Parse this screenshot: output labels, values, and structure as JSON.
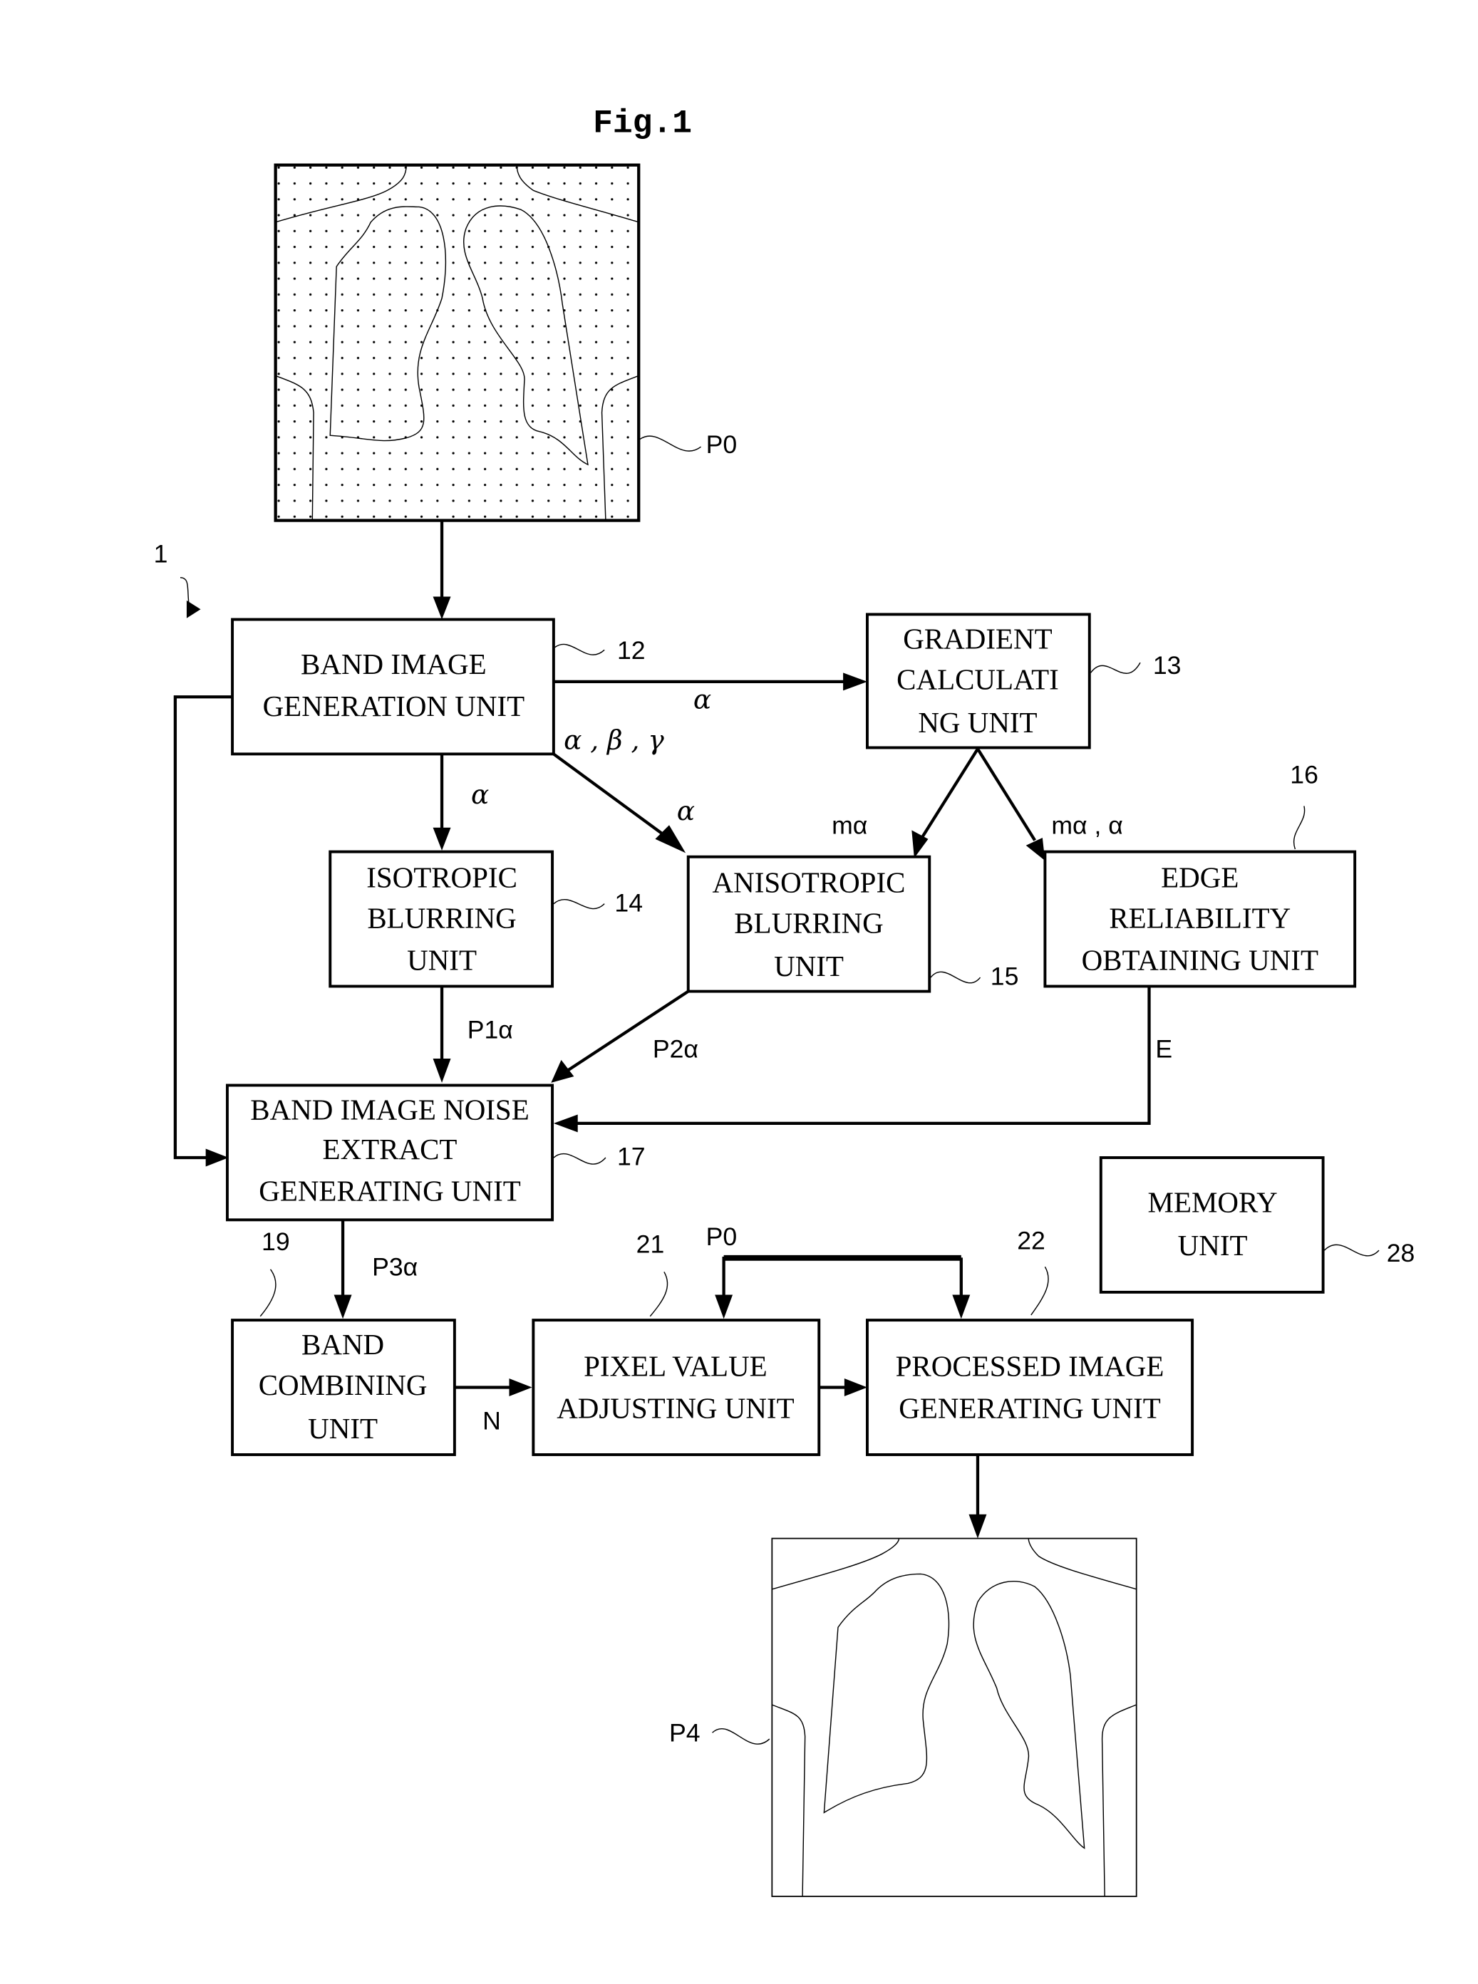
{
  "figure": {
    "title": "Fig.1",
    "system_ref": "1"
  },
  "images": {
    "input": {
      "label": "P0",
      "style": "dotted"
    },
    "output": {
      "label": "P4",
      "style": "plain"
    }
  },
  "units": [
    {
      "id": "band_image_generation",
      "ref": "12",
      "lines": [
        "BAND IMAGE",
        "GENERATION UNIT"
      ]
    },
    {
      "id": "gradient_calculating",
      "ref": "13",
      "lines": [
        "GRADIENT",
        "CALCULATI",
        "NG UNIT"
      ]
    },
    {
      "id": "isotropic_blurring",
      "ref": "14",
      "lines": [
        "ISOTROPIC",
        "BLURRING",
        "UNIT"
      ]
    },
    {
      "id": "anisotropic_blurring",
      "ref": "15",
      "lines": [
        "ANISOTROPIC",
        "BLURRING",
        "UNIT"
      ]
    },
    {
      "id": "edge_reliability",
      "ref": "16",
      "lines": [
        "EDGE",
        "RELIABILITY",
        "OBTAINING UNIT"
      ]
    },
    {
      "id": "band_noise_extract",
      "ref": "17",
      "lines": [
        "BAND IMAGE NOISE",
        "EXTRACT",
        "GENERATING UNIT"
      ]
    },
    {
      "id": "memory",
      "ref": "28",
      "lines": [
        "MEMORY",
        "UNIT"
      ]
    },
    {
      "id": "band_combining",
      "ref": "19",
      "lines": [
        "BAND",
        "COMBINING",
        "UNIT"
      ]
    },
    {
      "id": "pixel_value_adjusting",
      "ref": "21",
      "lines": [
        "PIXEL VALUE",
        "ADJUSTING UNIT"
      ]
    },
    {
      "id": "processed_image_generating",
      "ref": "22",
      "lines": [
        "PROCESSED IMAGE",
        "GENERATING UNIT"
      ]
    }
  ],
  "signals": {
    "to_gradient": "α",
    "band_outputs": "α , β , γ",
    "to_isotropic": "α",
    "to_anisotropic": "α",
    "grad_to_aniso": "mα",
    "grad_to_edge": "mα , α",
    "p1": "P1α",
    "p2": "P2α",
    "edge": "E",
    "p3": "P3α",
    "noise": "N",
    "p0_input": "P0"
  }
}
